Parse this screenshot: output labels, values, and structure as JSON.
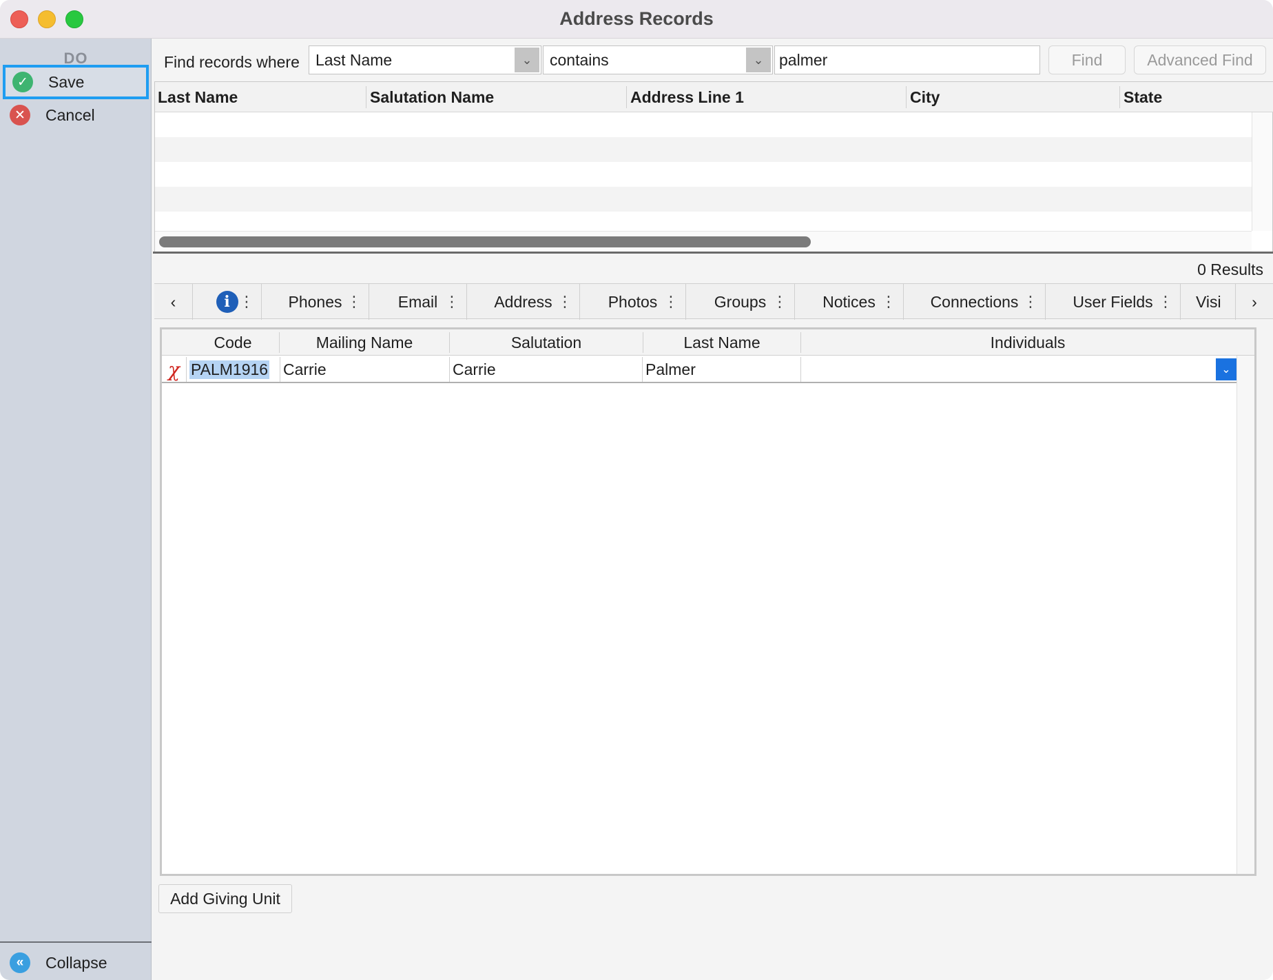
{
  "window": {
    "title": "Address Records"
  },
  "sidebar": {
    "header": "DO",
    "items": [
      {
        "label": "Save",
        "icon": "check-icon",
        "color": "#3eb471",
        "selected": true
      },
      {
        "label": "Cancel",
        "icon": "close-icon",
        "color": "#d9534f",
        "selected": false
      }
    ],
    "collapse_label": "Collapse"
  },
  "find": {
    "label": "Find records where",
    "field_value": "Last Name",
    "operator_value": "contains",
    "search_value": "palmer",
    "find_label": "Find",
    "advanced_label": "Advanced Find"
  },
  "results": {
    "columns": [
      "Last Name",
      "Salutation Name",
      "Address Line 1",
      "City",
      "State"
    ],
    "count_text": "0 Results"
  },
  "tabs": [
    "Phones",
    "Email",
    "Address",
    "Photos",
    "Groups",
    "Notices",
    "Connections",
    "User Fields",
    "Visi"
  ],
  "giving_units": {
    "columns": [
      "Code",
      "Mailing Name",
      "Salutation",
      "Last Name",
      "Individuals"
    ],
    "rows": [
      {
        "code": "PALM1916",
        "mailing_name": "Carrie",
        "salutation": "Carrie",
        "last_name": "Palmer",
        "individuals": ""
      }
    ],
    "add_label": "Add Giving Unit"
  },
  "colors": {
    "accent": "#1e9df1",
    "dropdown_blue": "#1a72e0",
    "sidebar": "#d0d6e0"
  }
}
